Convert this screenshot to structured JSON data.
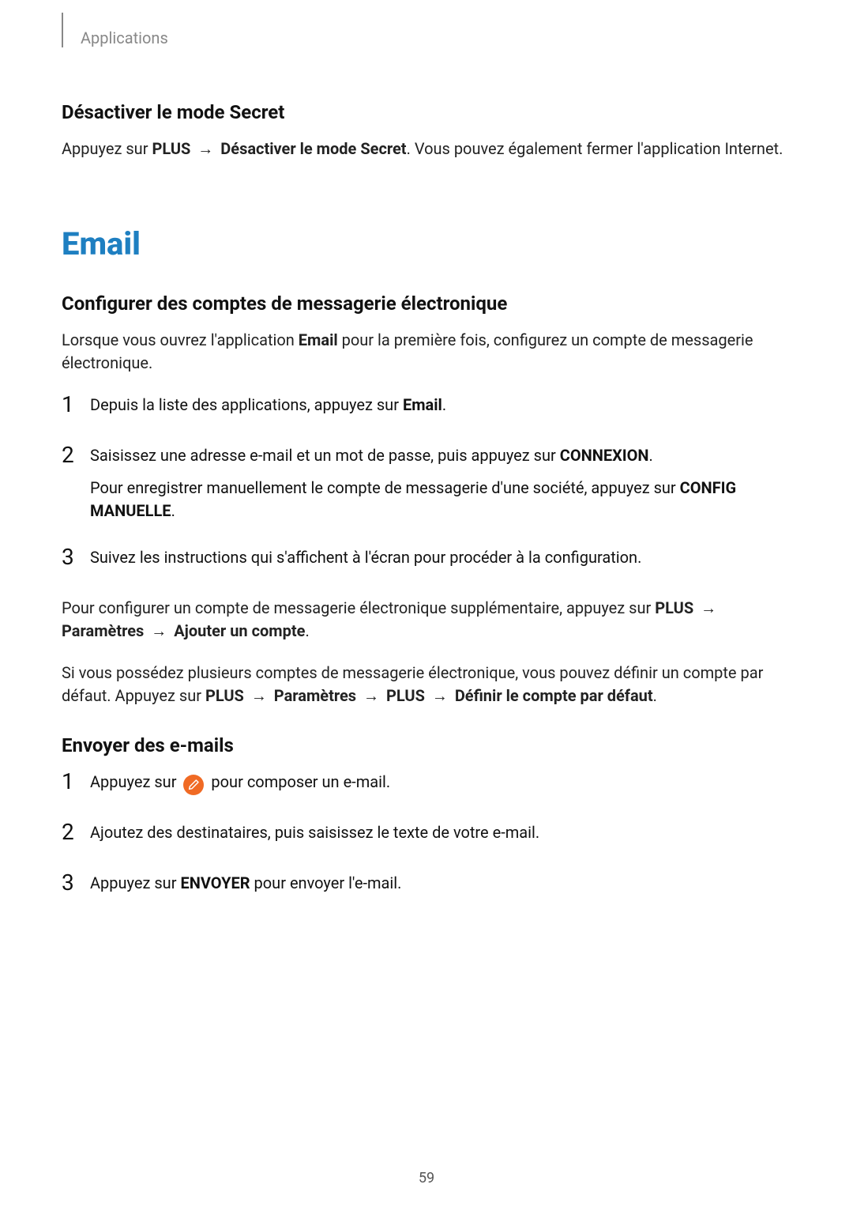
{
  "header": {
    "breadcrumb": "Applications"
  },
  "section1": {
    "title": "Désactiver le mode Secret",
    "p1_a": "Appuyez sur ",
    "p1_b": "PLUS",
    "p1_arrow": " → ",
    "p1_c": "Désactiver le mode Secret",
    "p1_d": ". Vous pouvez également fermer l'application Internet."
  },
  "main": {
    "title": "Email"
  },
  "section2": {
    "title": "Configurer des comptes de messagerie électronique",
    "intro_a": "Lorsque vous ouvrez l'application ",
    "intro_b": "Email",
    "intro_c": " pour la première fois, configurez un compte de messagerie électronique.",
    "step1_a": "Depuis la liste des applications, appuyez sur ",
    "step1_b": "Email",
    "step1_c": ".",
    "step2_a": "Saisissez une adresse e-mail et un mot de passe, puis appuyez sur ",
    "step2_b": "CONNEXION",
    "step2_c": ".",
    "step2_sub_a": "Pour enregistrer manuellement le compte de messagerie d'une société, appuyez sur ",
    "step2_sub_b": "CONFIG MANUELLE",
    "step2_sub_c": ".",
    "step3": "Suivez les instructions qui s'affichent à l'écran pour procéder à la configuration.",
    "after1_a": "Pour configurer un compte de messagerie électronique supplémentaire, appuyez sur ",
    "after1_b": "PLUS",
    "after1_arrow": " → ",
    "after1_c": "Paramètres",
    "after1_d": "Ajouter un compte",
    "after1_e": ".",
    "after2_a": "Si vous possédez plusieurs comptes de messagerie électronique, vous pouvez définir un compte par défaut. Appuyez sur ",
    "after2_b": "PLUS",
    "after2_c": "Paramètres",
    "after2_d": "PLUS",
    "after2_e": "Définir le compte par défaut",
    "after2_f": "."
  },
  "section3": {
    "title": "Envoyer des e-mails",
    "step1_a": "Appuyez sur ",
    "step1_b": " pour composer un e-mail.",
    "step2": "Ajoutez des destinataires, puis saisissez le texte de votre e-mail.",
    "step3_a": "Appuyez sur ",
    "step3_b": "ENVOYER",
    "step3_c": " pour envoyer l'e-mail."
  },
  "pagenum": "59"
}
